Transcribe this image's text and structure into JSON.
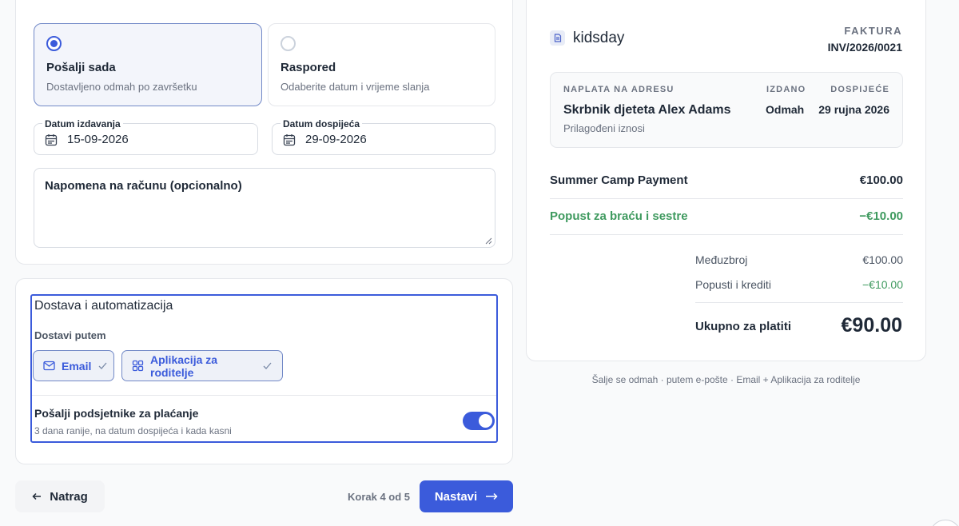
{
  "send_options": [
    {
      "title": "Pošalji sada",
      "subtitle": "Dostavljeno odmah po završetku",
      "selected": true
    },
    {
      "title": "Raspored",
      "subtitle": "Odaberite datum i vrijeme slanja",
      "selected": false
    }
  ],
  "dates": {
    "issue_label": "Datum izdavanja",
    "issue_value": "15-09-2026",
    "due_label": "Datum dospijeća",
    "due_value": "29-09-2026",
    "icon": "calendar-icon"
  },
  "note": {
    "label": "Napomena na računu (opcionalno)",
    "value": ""
  },
  "delivery": {
    "title": "Dostava i automatizacija",
    "deliver_via_label": "Dostavi putem",
    "channels": [
      {
        "label": "Email",
        "icon": "mail-icon",
        "selected": true
      },
      {
        "label": "Aplikacija za roditelje",
        "icon": "grid-icon",
        "selected": true
      }
    ],
    "reminders_title": "Pošalji podsjetnike za plaćanje",
    "reminders_subtitle": "3 dana ranije, na datum dospijeća i kada kasni",
    "reminders_enabled": true
  },
  "nav": {
    "back_label": "Natrag",
    "step_text": "Korak 4 od 5",
    "next_label": "Nastavi"
  },
  "invoice": {
    "brand": "kidsday",
    "kind": "FAKTURA",
    "number": "INV/2026/0021",
    "bill_to_caption": "NAPLATA NA ADRESU",
    "bill_to_name": "Skrbnik djeteta Alex Adams",
    "bill_to_sub": "Prilagođeni iznosi",
    "issued_caption": "IZDANO",
    "issued_value": "Odmah",
    "due_caption": "DOSPIJEĆE",
    "due_value": "29 rujna 2026",
    "lines": [
      {
        "label": "Summer Camp Payment",
        "amount": "€100.00"
      },
      {
        "label": "Popust za braću i sestre",
        "amount": "−€10.00"
      }
    ],
    "subtotal_label": "Međuzbroj",
    "subtotal_value": "€100.00",
    "discounts_label": "Popusti i krediti",
    "discounts_value": "−€10.00",
    "total_label": "Ukupno za platiti",
    "total_value": "€90.00"
  },
  "footnote": "Šalje se odmah · putem e-pošte · Email + Aplikacija za roditelje",
  "colors": {
    "accent": "#3b5bdb",
    "discount": "#3f9a5f"
  }
}
